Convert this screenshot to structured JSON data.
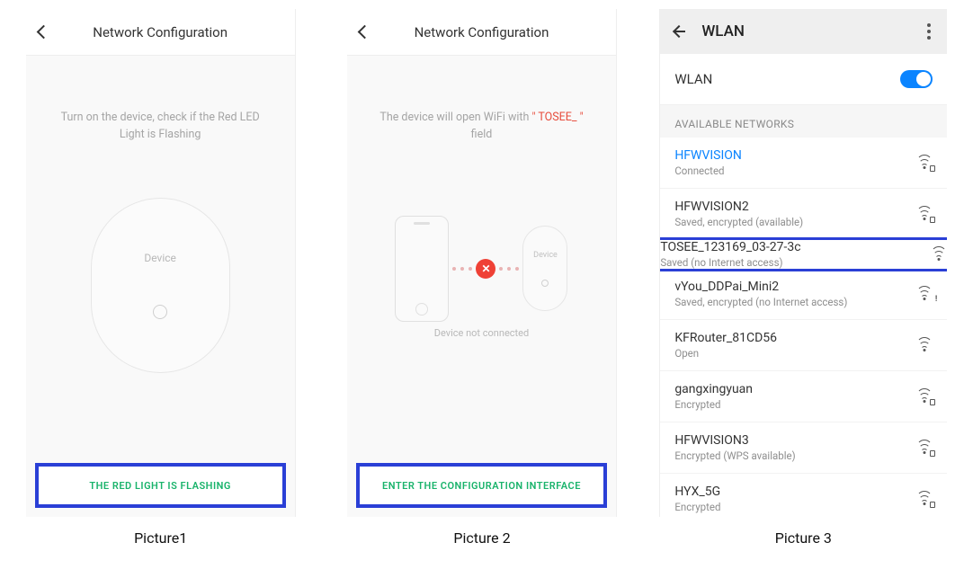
{
  "picture1": {
    "caption": "Picture1",
    "header": {
      "title": "Network Configuration"
    },
    "instruction": "Turn on the device, check if the Red LED Light is Flashing",
    "deviceLabel": "Device",
    "cta": "THE RED LIGHT IS FLASHING"
  },
  "picture2": {
    "caption": "Picture 2",
    "header": {
      "title": "Network Configuration"
    },
    "instruction_prefix": "The device will open WiFi with ",
    "instruction_highlight": "\" TOSEE_ \"",
    "instruction_suffix": " field",
    "deviceLabel": "Device",
    "notConnected": "Device not connected",
    "cta": "ENTER THE CONFIGURATION INTERFACE"
  },
  "picture3": {
    "caption": "Picture 3",
    "header": {
      "title": "WLAN"
    },
    "wlanToggle": {
      "label": "WLAN",
      "on": true
    },
    "sectionLabel": "AVAILABLE NETWORKS",
    "networks": [
      {
        "name": "HFWVISION",
        "status": "Connected",
        "active": true,
        "lock": true
      },
      {
        "name": "HFWVISION2",
        "status": "Saved, encrypted (available)",
        "lock": true
      },
      {
        "name": "TOSEE_123169_03-27-3c",
        "status": "Saved (no Internet access)",
        "highlighted": true,
        "warn": true
      },
      {
        "name": "vYou_DDPai_Mini2",
        "status": "Saved, encrypted (no Internet access)",
        "warn": true
      },
      {
        "name": "KFRouter_81CD56",
        "status": "Open"
      },
      {
        "name": "gangxingyuan",
        "status": "Encrypted",
        "lock": true
      },
      {
        "name": "HFWVISION3",
        "status": "Encrypted (WPS available)",
        "lock": true
      },
      {
        "name": "HYX_5G",
        "status": "Encrypted",
        "lock": true
      }
    ]
  }
}
